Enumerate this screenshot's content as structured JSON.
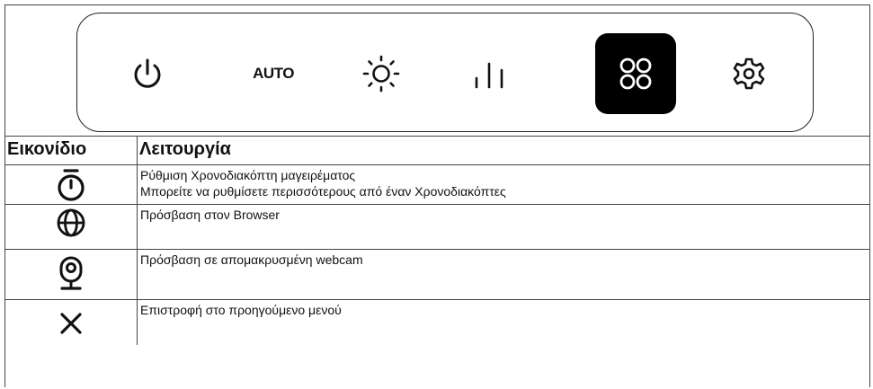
{
  "control_panel": {
    "buttons": [
      {
        "name": "power",
        "icon": "power-icon"
      },
      {
        "name": "auto",
        "label": "AUTO"
      },
      {
        "name": "brightness",
        "icon": "sun-icon"
      },
      {
        "name": "levels",
        "icon": "bars-icon"
      },
      {
        "name": "apps",
        "icon": "four-circles-icon",
        "active": true
      },
      {
        "name": "settings",
        "icon": "gear-icon"
      }
    ]
  },
  "legend": {
    "headers": {
      "icon": "Εικονίδιο",
      "function": "Λειτουργία"
    },
    "rows": [
      {
        "icon": "stopwatch-icon",
        "lines": [
          "Ρύθμιση Χρονοδιακόπτη μαγειρέματος",
          "Μπορείτε να ρυθμίσετε περισσότερους από έναν Χρονοδιακόπτες"
        ]
      },
      {
        "icon": "globe-icon",
        "lines": [
          "Πρόσβαση στον Browser"
        ]
      },
      {
        "icon": "webcam-icon",
        "lines": [
          "Πρόσβαση σε απομακρυσμένη webcam"
        ]
      },
      {
        "icon": "close-icon",
        "lines": [
          "Επιστροφή στο προηγούμενο μενού"
        ]
      }
    ]
  },
  "colors": {
    "ink": "#111111",
    "active_bg": "#000000",
    "active_fg": "#ffffff"
  }
}
